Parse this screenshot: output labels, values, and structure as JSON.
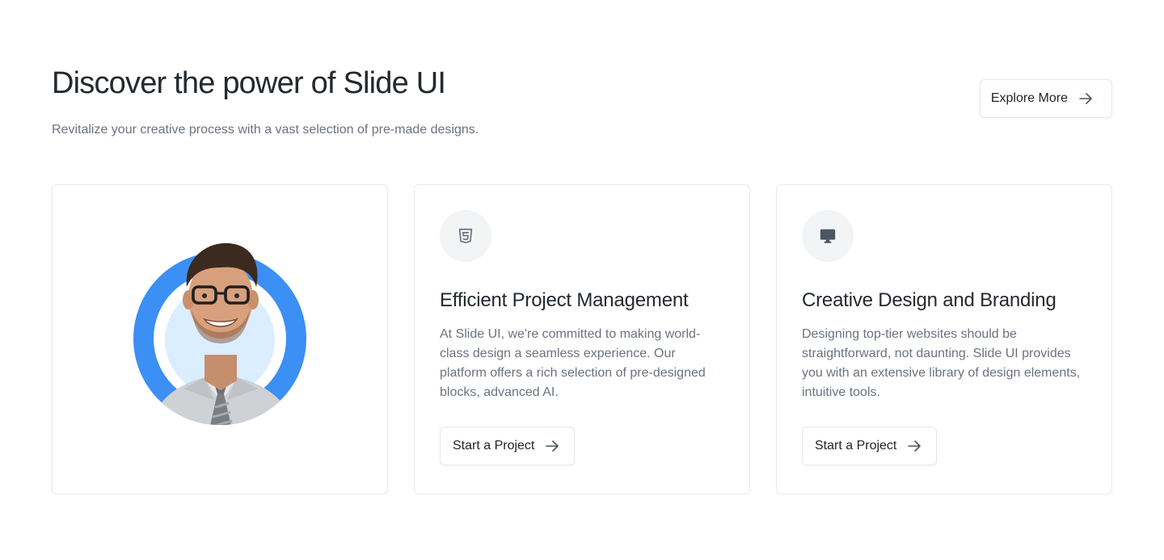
{
  "header": {
    "title": "Discover the power of Slide UI",
    "subtitle": "Revitalize your creative process with a vast selection of pre-made designs.",
    "explore_label": "Explore More"
  },
  "colors": {
    "ring": "#3b8ff5",
    "ring_inner": "#dbeeff",
    "text_primary": "#24292f",
    "text_secondary": "#6b7280",
    "border": "#e8eaed"
  },
  "cards": [
    {
      "type": "image",
      "image": "portrait-of-smiling-man-with-glasses-and-tie"
    },
    {
      "type": "feature",
      "icon": "html5-icon",
      "title": "Efficient Project Management",
      "description": "At Slide UI, we're committed to making world-class design a seamless experience. Our platform offers a rich selection of pre-designed blocks, advanced AI.",
      "button_label": "Start a Project"
    },
    {
      "type": "feature",
      "icon": "monitor-icon",
      "title": "Creative Design and Branding",
      "description": "Designing top-tier websites should be straightforward, not daunting. Slide UI provides you with an extensive library of design elements, intuitive tools.",
      "button_label": "Start a Project"
    }
  ]
}
